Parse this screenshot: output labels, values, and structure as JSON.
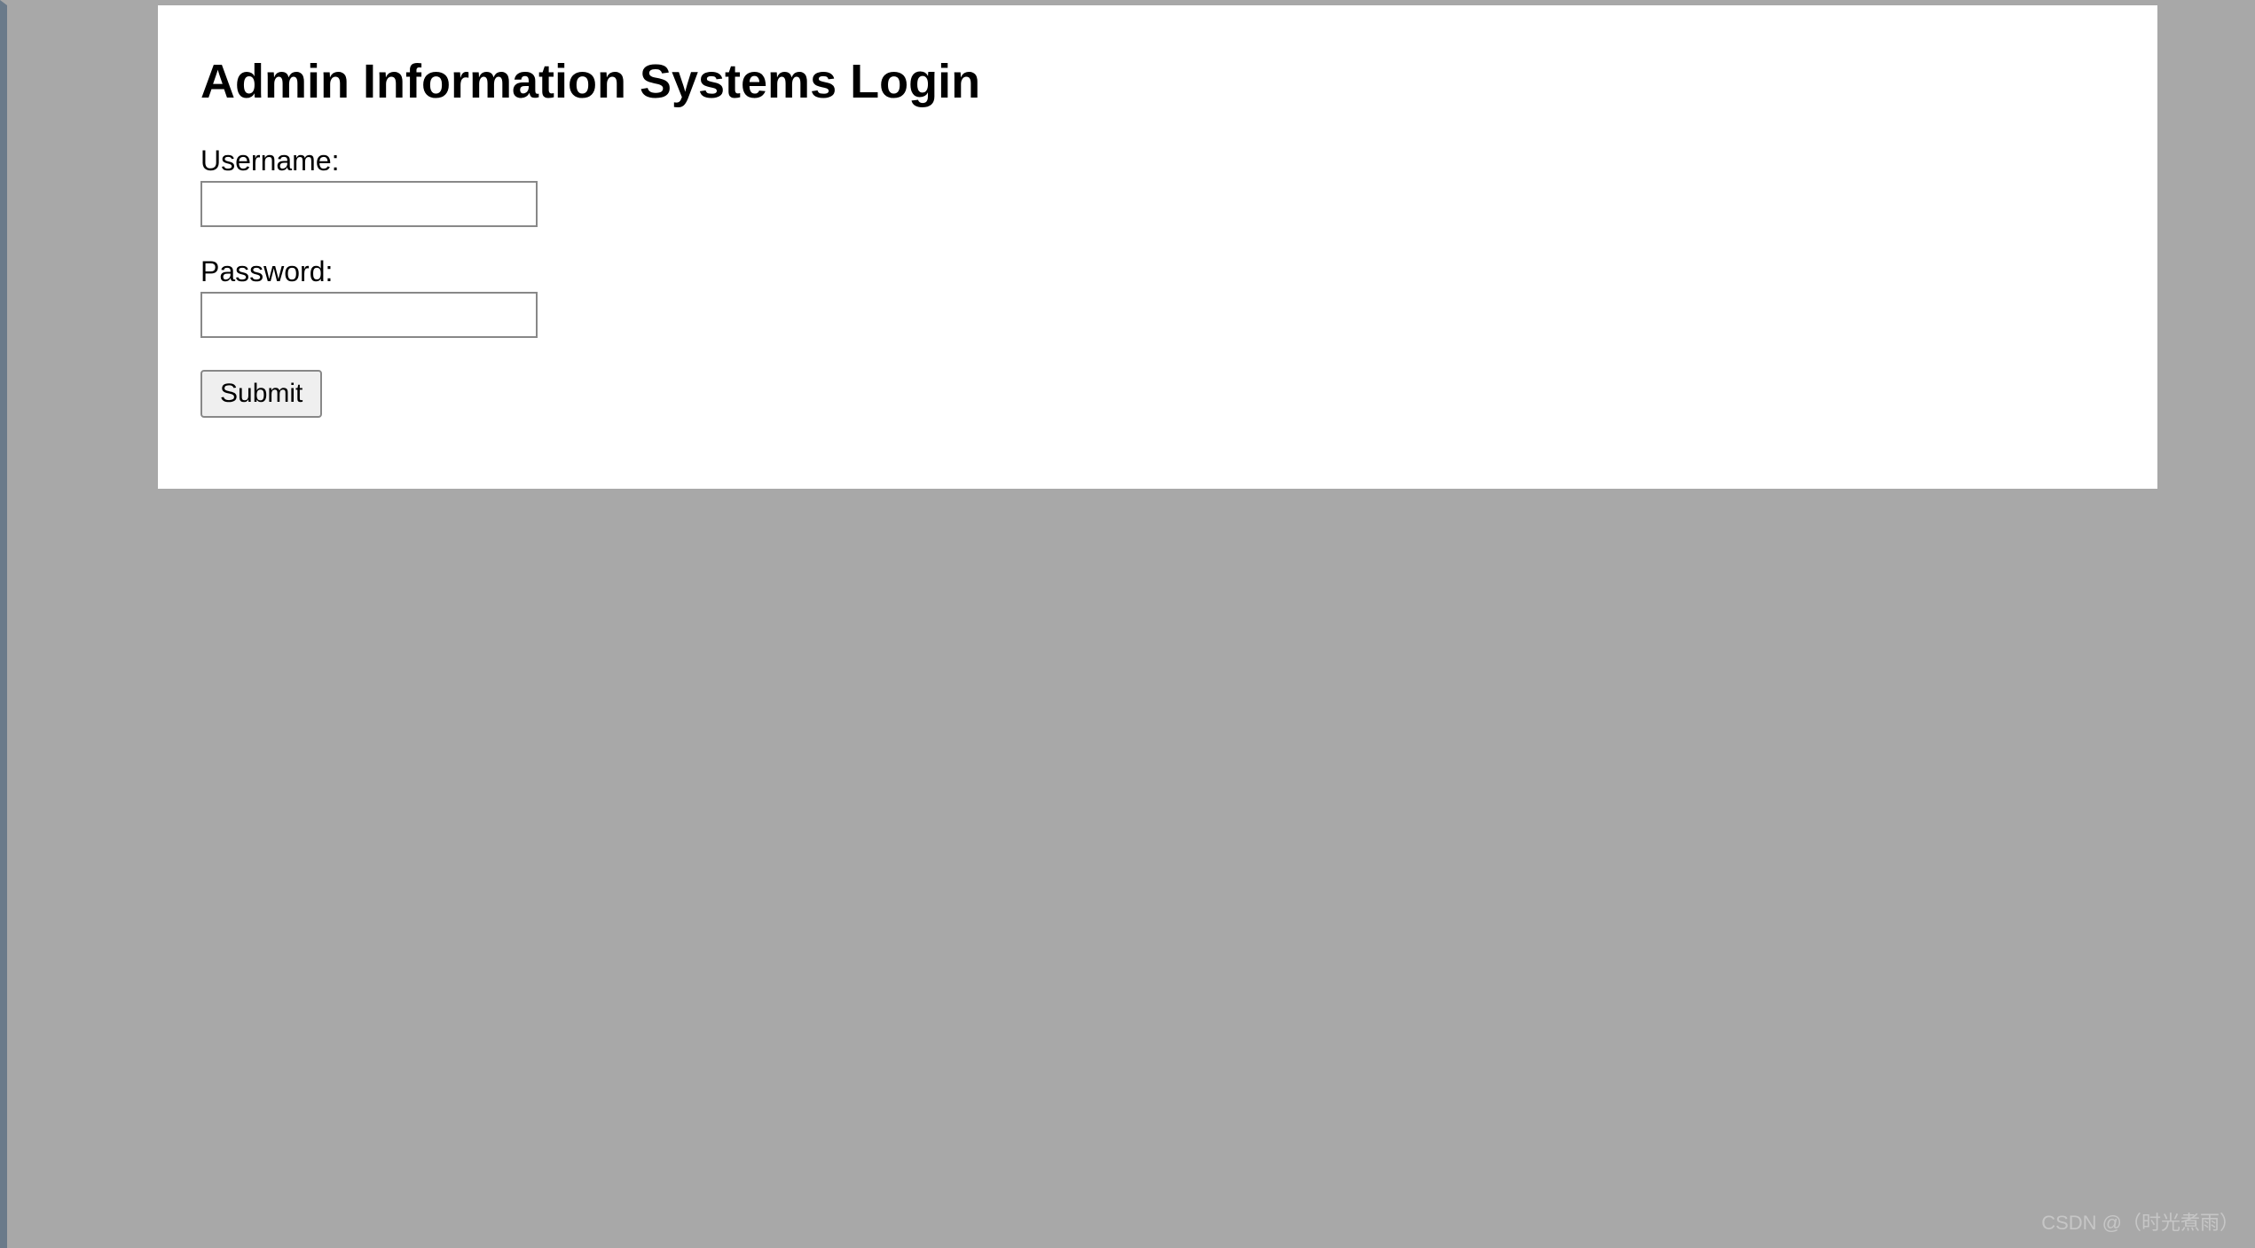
{
  "page": {
    "title": "Admin Information Systems Login"
  },
  "form": {
    "username_label": "Username:",
    "username_value": "",
    "password_label": "Password:",
    "password_value": "",
    "submit_label": "Submit"
  },
  "watermark": "CSDN @（时光煮雨）"
}
